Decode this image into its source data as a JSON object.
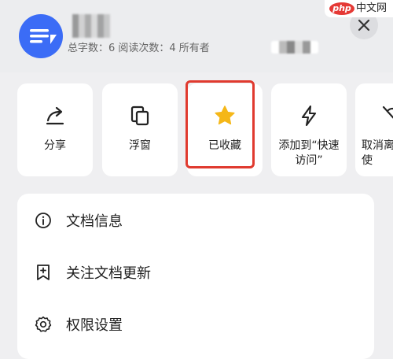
{
  "watermark": {
    "logo": "php",
    "text": "中文网"
  },
  "header": {
    "meta": "总字数：6  阅读次数：4  所有者",
    "close_icon": "close-icon"
  },
  "actions": [
    {
      "id": "share",
      "label": "分享",
      "icon": "share-icon"
    },
    {
      "id": "float",
      "label": "浮窗",
      "icon": "float-window-icon"
    },
    {
      "id": "favorite",
      "label": "已收藏",
      "icon": "star-icon",
      "active_color": "#f5b718"
    },
    {
      "id": "quick-access",
      "label_line1": "添加到“快速",
      "label_line2": "访问”",
      "icon": "lightning-icon"
    },
    {
      "id": "cancel-partial",
      "label_line1": "取消离",
      "label_line2": "使",
      "icon": "slash-icon"
    }
  ],
  "highlight_color": "#e03a2f",
  "menu": [
    {
      "id": "doc-info",
      "label": "文档信息",
      "icon": "info-icon"
    },
    {
      "id": "follow-updates",
      "label": "关注文档更新",
      "icon": "bookmark-plus-icon"
    },
    {
      "id": "permissions",
      "label": "权限设置",
      "icon": "gear-icon"
    }
  ]
}
